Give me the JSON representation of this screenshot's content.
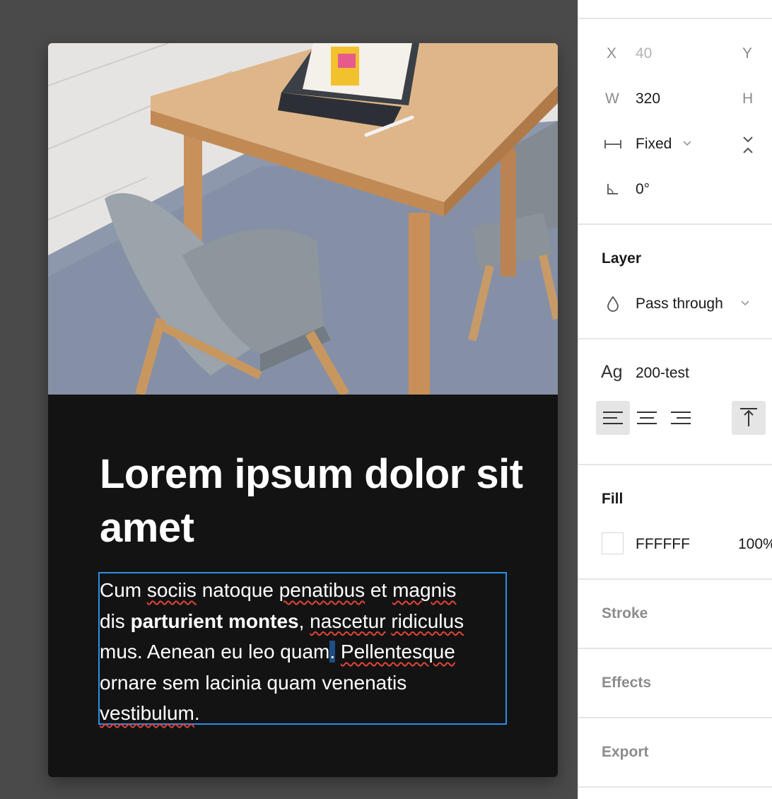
{
  "card": {
    "headline": "Lorem ipsum dolor sit amet",
    "body": {
      "w1": "Cum",
      "w2": "sociis",
      "w3": "natoque",
      "w4": "penatibus",
      "w5": "et",
      "w6": "magnis",
      "w7": "dis",
      "bold": "parturient montes",
      "w8": ",",
      "w9": "nascetur",
      "w10": "ridiculus",
      "w11": "mus. Aenean eu leo quam",
      "sel": ".",
      "w12": "Pellentesque",
      "w13": "ornare sem lacinia quam venenatis",
      "w14": "vestibulum",
      "w15": "."
    }
  },
  "panel": {
    "x_label": "X",
    "x_value": "40",
    "y_label": "Y",
    "w_label": "W",
    "w_value": "320",
    "h_label": "H",
    "resize_value": "Fixed",
    "rotation_value": "0°",
    "layer_title": "Layer",
    "blend_value": "Pass through",
    "text_style_icon_label": "Ag",
    "text_style_value": "200-test",
    "fill_title": "Fill",
    "fill_hex": "FFFFFF",
    "fill_opacity": "100%",
    "stroke_title": "Stroke",
    "effects_title": "Effects",
    "export_title": "Export"
  },
  "colors": {
    "canvas": "#4a4a4a",
    "card": "#131313",
    "selection": "#2d8ee6",
    "spellcheck": "#e0443a"
  }
}
